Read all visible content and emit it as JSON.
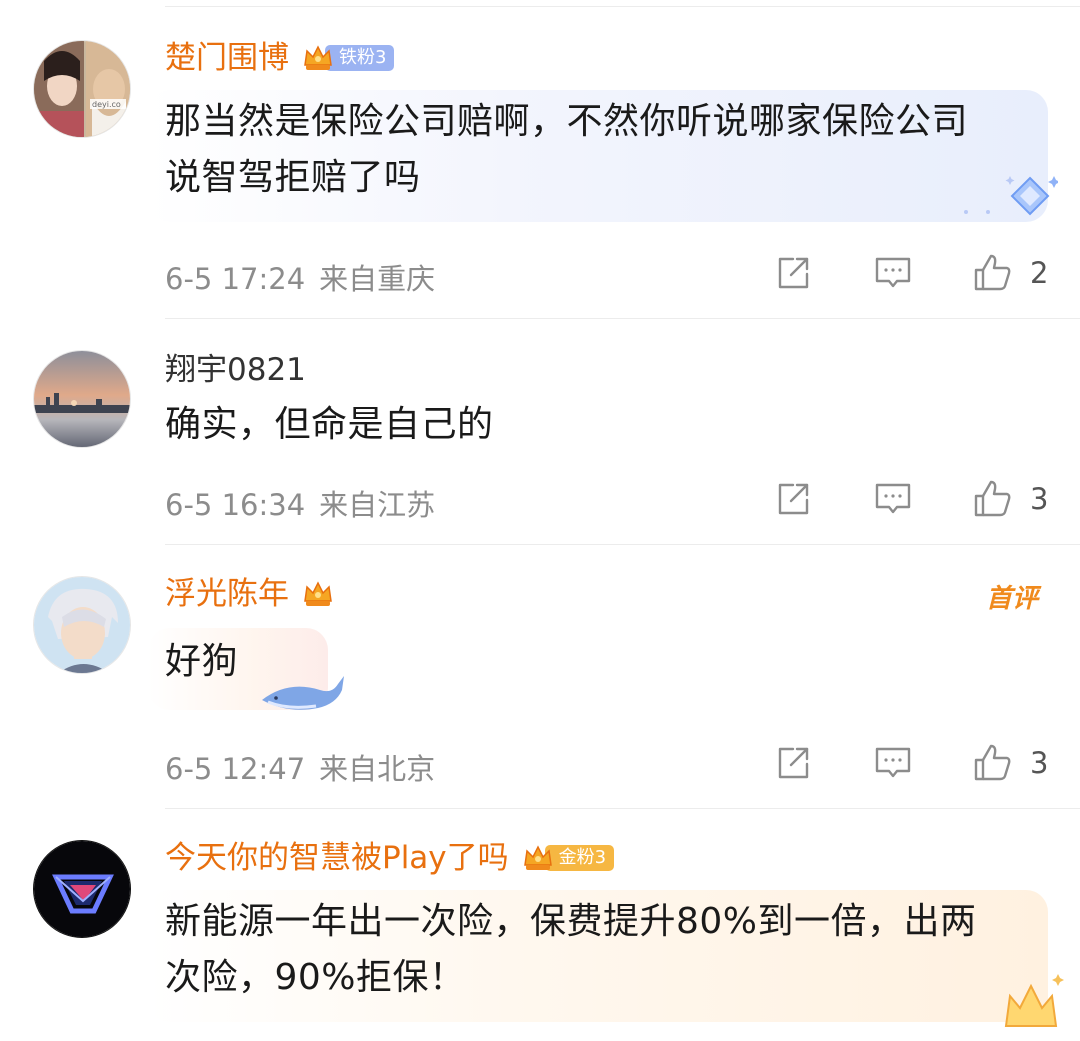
{
  "comments": [
    {
      "username": "楚门围博",
      "fan_badge": "铁粉3",
      "text": "那当然是保险公司赔啊，不然你听说哪家保险公司\n说智驾拒赔了吗",
      "time": "6-5 17:24",
      "location": "来自重庆",
      "likes": "2",
      "avatar_watermark": "deyi.co"
    },
    {
      "username": "翔宇0821",
      "text": "确实，但命是自己的",
      "time": "6-5 16:34",
      "location": "来自江苏",
      "likes": "3"
    },
    {
      "username": "浮光陈年",
      "first_comment_tag": "首评",
      "text": "好狗",
      "time": "6-5 12:47",
      "location": "来自北京",
      "likes": "3"
    },
    {
      "username": "今天你的智慧被Play了吗",
      "fan_badge": "金粉3",
      "text": "新能源一年出一次险，保费提升80%到一倍，出两\n次险，90%拒保！"
    }
  ],
  "icons": [
    "share-icon",
    "reply-icon",
    "like-icon",
    "crown-icon"
  ],
  "colors": {
    "vip_name": "#e8700f",
    "meta_gray": "#8c8c8c",
    "iron_badge": "#9bb3f2",
    "gold_badge": "#f6b742",
    "first_tag": "#f08a1c"
  }
}
